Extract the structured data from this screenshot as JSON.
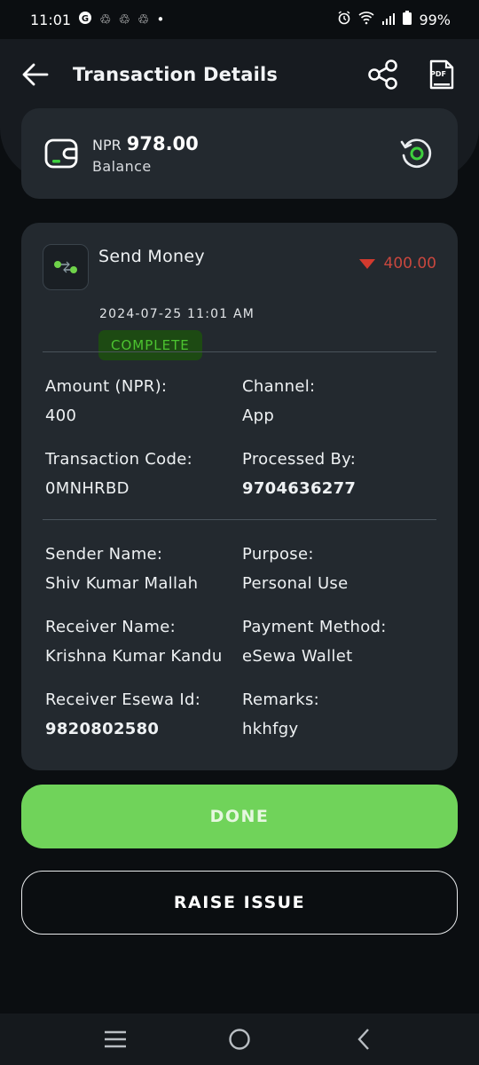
{
  "status_bar": {
    "time": "11:01",
    "battery": "99%",
    "notification_icons": [
      "google-icon",
      "recycle-icon",
      "recycle-icon",
      "recycle-icon",
      "dot-icon"
    ],
    "system_icons": [
      "alarm-icon",
      "wifi-icon",
      "signal-icon",
      "battery-icon"
    ]
  },
  "header": {
    "title": "Transaction Details",
    "actions": [
      "share-icon",
      "pdf-icon"
    ],
    "pdf_label": "PDF"
  },
  "balance": {
    "currency": "NPR",
    "amount": "978.00",
    "label": "Balance"
  },
  "transaction": {
    "type": "Send Money",
    "amount": "400.00",
    "direction": "debit",
    "datetime": "2024-07-25 11:01 AM",
    "status": "COMPLETE",
    "fields_group1": [
      {
        "label": "Amount (NPR):",
        "value": "400",
        "bold": false
      },
      {
        "label": "Channel:",
        "value": "App",
        "bold": false
      },
      {
        "label": "Transaction Code:",
        "value": "0MNHRBD",
        "bold": false
      },
      {
        "label": "Processed By:",
        "value": "9704636277",
        "bold": true
      }
    ],
    "fields_group2": [
      {
        "label": "Sender Name:",
        "value": "Shiv Kumar Mallah",
        "bold": false
      },
      {
        "label": "Purpose:",
        "value": "Personal Use",
        "bold": false
      },
      {
        "label": "Receiver Name:",
        "value": "Krishna Kumar Kandu",
        "bold": false
      },
      {
        "label": "Payment Method:",
        "value": "eSewa Wallet",
        "bold": false
      },
      {
        "label": "Receiver Esewa Id:",
        "value": "9820802580",
        "bold": true
      },
      {
        "label": "Remarks:",
        "value": "hkhfgy",
        "bold": false
      }
    ]
  },
  "buttons": {
    "done": "DONE",
    "raise_issue": "RAISE ISSUE"
  },
  "colors": {
    "background": "#0b0e11",
    "card": "#23292f",
    "accent_green": "#70d35a",
    "debit_red": "#c9473e",
    "status_green": "#4cc330"
  }
}
